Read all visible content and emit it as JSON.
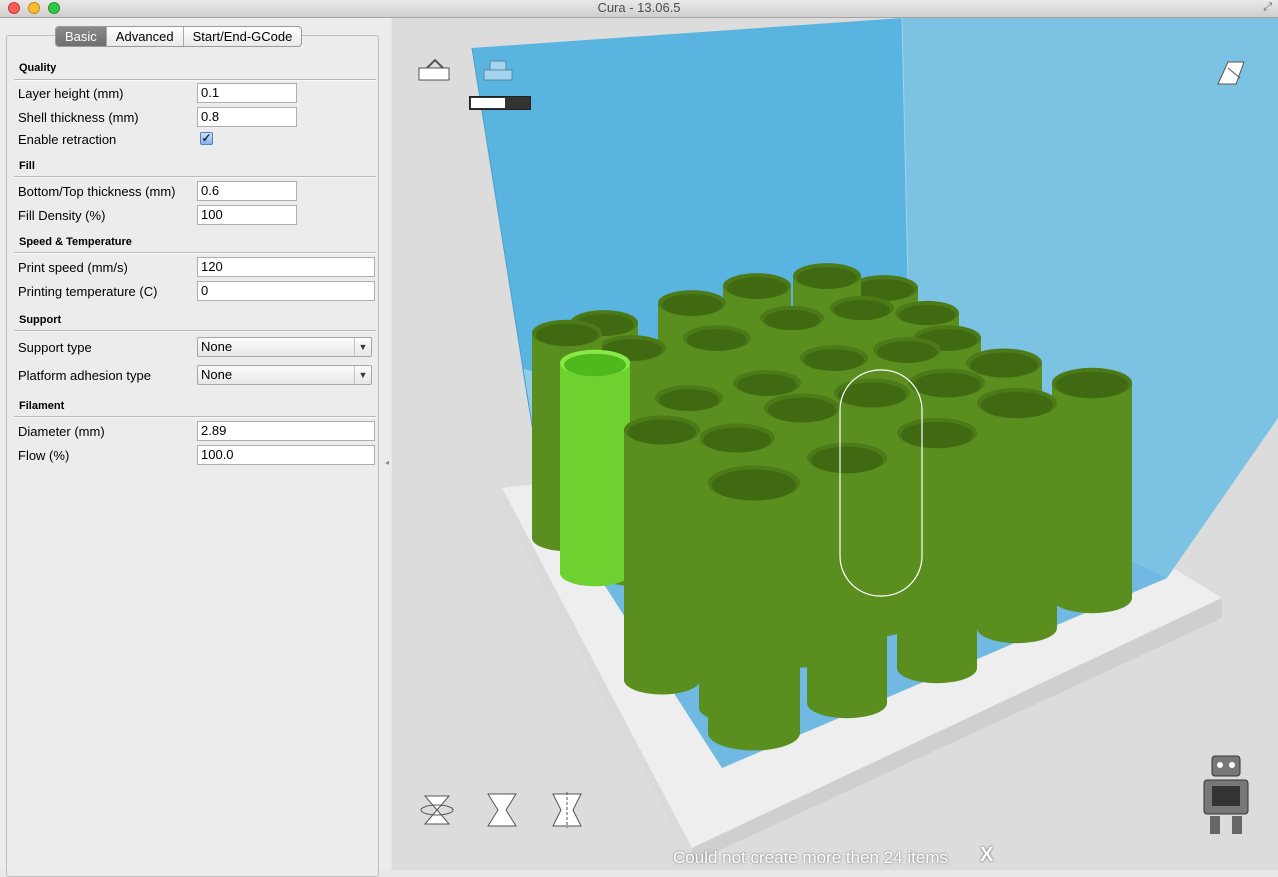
{
  "window": {
    "title": "Cura - 13.06.5"
  },
  "tabs": [
    "Basic",
    "Advanced",
    "Start/End-GCode"
  ],
  "quality": {
    "heading": "Quality",
    "layer_height_label": "Layer height (mm)",
    "layer_height": "0.1",
    "shell_thickness_label": "Shell thickness (mm)",
    "shell_thickness": "0.8",
    "retraction_label": "Enable retraction",
    "retraction_checked": true
  },
  "fill": {
    "heading": "Fill",
    "bottom_top_label": "Bottom/Top thickness (mm)",
    "bottom_top": "0.6",
    "density_label": "Fill Density (%)",
    "density": "100"
  },
  "speed": {
    "heading": "Speed & Temperature",
    "print_speed_label": "Print speed (mm/s)",
    "print_speed": "120",
    "temp_label": "Printing temperature (C)",
    "temp": "0"
  },
  "support": {
    "heading": "Support",
    "type_label": "Support type",
    "type": "None",
    "adhesion_label": "Platform adhesion type",
    "adhesion": "None"
  },
  "filament": {
    "heading": "Filament",
    "diameter_label": "Diameter (mm)",
    "diameter": "2.89",
    "flow_label": "Flow (%)",
    "flow": "100.0"
  },
  "viewport": {
    "notice": "Could not create more then 24 items",
    "close_glyph": "X",
    "layer_slider_fraction": 0.6,
    "icons": [
      "load-icon",
      "print-icon",
      "view-mode-icon",
      "rotate-icon",
      "scale-icon",
      "mirror-icon",
      "robot-icon"
    ]
  },
  "colors": {
    "build_volume": "#5ab4e0",
    "model": "#5a8f1f",
    "model_selected": "#7ce23a",
    "platform": "#eeeeee"
  }
}
